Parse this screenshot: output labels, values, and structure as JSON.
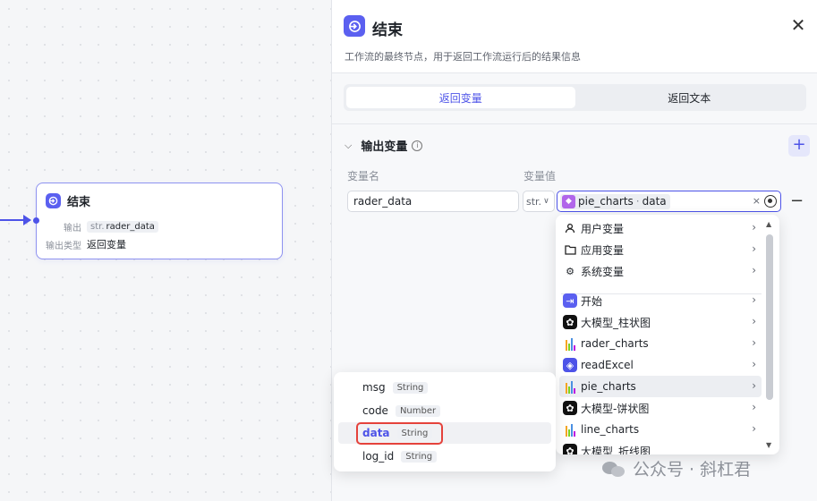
{
  "node": {
    "title": "结束",
    "output_label": "输出",
    "output_type_prefix": "str.",
    "output_var": "rader_data",
    "output_kind_label": "输出类型",
    "output_kind_value": "返回变量"
  },
  "panel": {
    "title": "结束",
    "description": "工作流的最终节点，用于返回工作流运行后的结果信息",
    "tabs": [
      {
        "label": "返回变量",
        "active": true
      },
      {
        "label": "返回文本",
        "active": false
      }
    ],
    "section_title": "输出变量",
    "col_name_label": "变量名",
    "col_value_label": "变量值",
    "row": {
      "name": "rader_data",
      "type": "str.",
      "ref_node": "pie_charts",
      "ref_field": "data"
    }
  },
  "dropdown": {
    "groups": [
      {
        "label": "用户变量",
        "icon": "user-icon"
      },
      {
        "label": "应用变量",
        "icon": "folder-icon"
      },
      {
        "label": "系统变量",
        "icon": "gear-icon"
      }
    ],
    "nodes": [
      {
        "label": "开始",
        "icon": "start-icon"
      },
      {
        "label": "大模型_柱状图",
        "icon": "llm-icon"
      },
      {
        "label": "rader_charts",
        "icon": "chart-icon"
      },
      {
        "label": "readExcel",
        "icon": "code-icon"
      },
      {
        "label": "pie_charts",
        "icon": "chart-icon"
      },
      {
        "label": "大模型-饼状图",
        "icon": "llm-icon"
      },
      {
        "label": "line_charts",
        "icon": "chart-icon"
      },
      {
        "label": "大模型_折线图",
        "icon": "llm-icon"
      }
    ]
  },
  "sub_dropdown": {
    "fields": [
      {
        "name": "msg",
        "type": "String"
      },
      {
        "name": "code",
        "type": "Number"
      },
      {
        "name": "data",
        "type": "String"
      },
      {
        "name": "log_id",
        "type": "String"
      }
    ]
  },
  "watermark": {
    "text": "公众号 · 斜杠君"
  },
  "colors": {
    "accent": "#4d53e8",
    "highlight_box": "#e5423b"
  }
}
